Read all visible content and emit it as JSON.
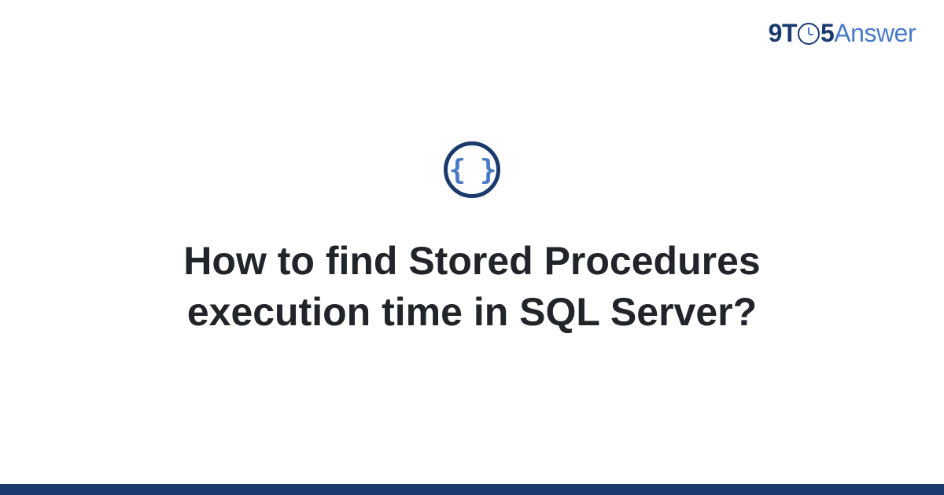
{
  "logo": {
    "part_9t": "9T",
    "part_5": "5",
    "part_answer": "Answer"
  },
  "topic_icon": {
    "name": "code-braces-icon",
    "glyph": "{ }"
  },
  "heading": "How to find Stored Procedures execution time in SQL Server?",
  "colors": {
    "brand_dark": "#1a3a6e",
    "brand_light": "#4a7bc8",
    "text": "#212529"
  }
}
